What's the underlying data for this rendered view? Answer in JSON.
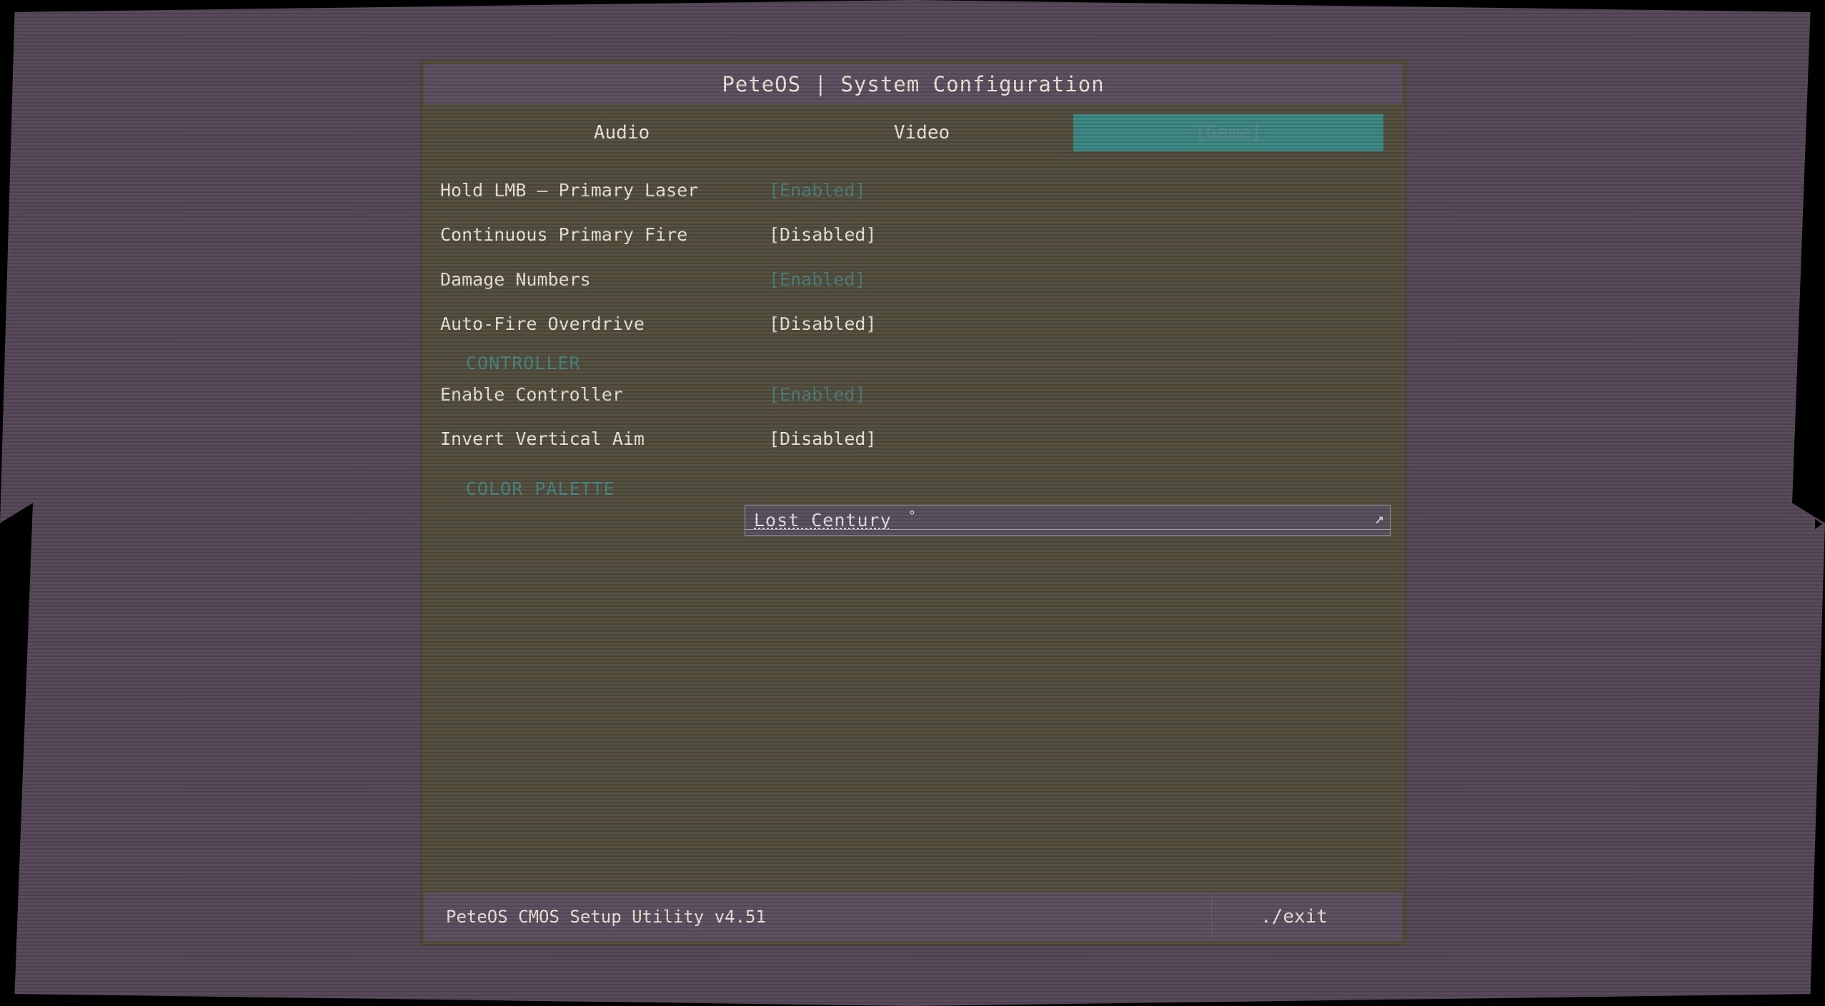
{
  "window": {
    "title": "PeteOS | System Configuration"
  },
  "tabs": [
    {
      "label": "Audio",
      "active": false
    },
    {
      "label": "Video",
      "active": false
    },
    {
      "label": "[Game]",
      "active": true
    }
  ],
  "settings": [
    {
      "label": "Hold LMB – Primary Laser",
      "value": "[Enabled]"
    },
    {
      "label": "Continuous Primary Fire",
      "value": "[Disabled]"
    },
    {
      "label": "Damage Numbers",
      "value": "[Enabled]"
    },
    {
      "label": "Auto-Fire Overdrive",
      "value": "[Disabled]"
    }
  ],
  "controller": {
    "heading": "CONTROLLER",
    "settings": [
      {
        "label": "Enable Controller",
        "value": "[Enabled]"
      },
      {
        "label": "Invert Vertical Aim",
        "value": "[Disabled]"
      }
    ]
  },
  "color_palette": {
    "heading": "COLOR PALETTE",
    "selected": "Lost Century",
    "marker": "°",
    "arrow": "↗"
  },
  "footer": {
    "version": "PeteOS CMOS Setup Utility v4.51",
    "exit_label": "./exit"
  },
  "colors": {
    "frame": "#584a5a",
    "panel": "#55503f",
    "accent": "#3f8a86",
    "enabled_text": "#4e807e",
    "text": "#ece6da"
  }
}
